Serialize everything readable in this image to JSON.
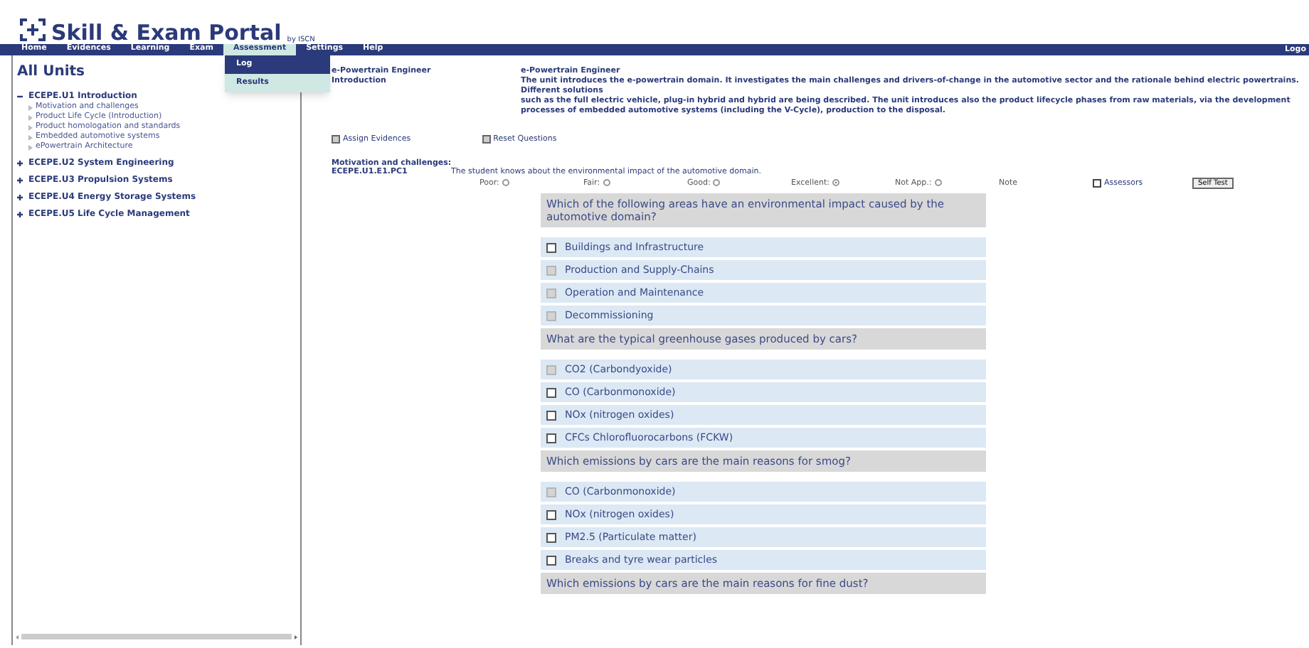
{
  "header": {
    "title": "Skill & Exam Portal",
    "byline": "by ISCN"
  },
  "nav": {
    "items": [
      {
        "label": "Home",
        "selected": false
      },
      {
        "label": "Evidences",
        "selected": false
      },
      {
        "label": "Learning",
        "selected": false
      },
      {
        "label": "Exam",
        "selected": false
      },
      {
        "label": "Assessment",
        "selected": true
      },
      {
        "label": "Settings",
        "selected": false
      },
      {
        "label": "Help",
        "selected": false
      }
    ],
    "right_link": "Logo",
    "dropdown": [
      {
        "label": "Log",
        "selected": true
      },
      {
        "label": "Results",
        "selected": false
      }
    ]
  },
  "sidebar": {
    "title": "All Units",
    "units": [
      {
        "label": "ECEPE.U1 Introduction",
        "expanded": true,
        "children": [
          {
            "label": "Motivation and challenges"
          },
          {
            "label": "Product Life Cycle (Introduction)"
          },
          {
            "label": "Product homologation and standards"
          },
          {
            "label": "Embedded automotive systems"
          },
          {
            "label": "ePowertrain Architecture"
          }
        ]
      },
      {
        "label": "ECEPE.U2 System Engineering",
        "expanded": false
      },
      {
        "label": "ECEPE.U3 Propulsion Systems",
        "expanded": false
      },
      {
        "label": "ECEPE.U4 Energy Storage Systems",
        "expanded": false
      },
      {
        "label": "ECEPE.U5 Life Cycle Management",
        "expanded": false
      }
    ]
  },
  "info": [
    {
      "label": "e-Powertrain Engineer",
      "value": "e-Powertrain Engineer"
    },
    {
      "label": "Introduction",
      "value": "The unit introduces the e-powertrain domain. It investigates the main challenges and drivers-of-change in the automotive sector and the rationale behind electric powertrains. Different solutions\nsuch as the full electric vehicle, plug-in hybrid and hybrid are being described. The unit introduces also the product lifecycle phases from raw materials, via the development processes of embedded automotive systems (including the V-Cycle), production to the disposal."
    }
  ],
  "actions": [
    "Assign Evidences",
    "Reset Questions"
  ],
  "section_title": "Motivation and challenges:",
  "criterion": {
    "code": "ECEPE.U1.E1.PC1",
    "text": "The student knows about the environmental impact of the automotive domain."
  },
  "ratings": [
    {
      "label": "Poor:",
      "selected": false
    },
    {
      "label": "Fair:",
      "selected": false
    },
    {
      "label": "Good:",
      "selected": false
    },
    {
      "label": "Excellent:",
      "selected": true
    },
    {
      "label": "Not App.:",
      "selected": false
    }
  ],
  "note": "Note",
  "assessors": "Assessors",
  "self_test": "Self Test",
  "questions": [
    {
      "text": "Which of the following areas have an environmental impact caused by the automotive domain?",
      "answers": [
        {
          "label": "Buildings and Infrastructure",
          "checked": false
        },
        {
          "label": "Production and Supply-Chains",
          "checked": true
        },
        {
          "label": "Operation and Maintenance",
          "checked": true
        },
        {
          "label": "Decommissioning",
          "checked": true
        }
      ]
    },
    {
      "text": "What are the typical greenhouse gases produced by cars?",
      "answers": [
        {
          "label": "CO2 (Carbondyoxide)",
          "checked": true
        },
        {
          "label": "CO (Carbonmonoxide)",
          "checked": false
        },
        {
          "label": "NOx (nitrogen oxides)",
          "checked": false
        },
        {
          "label": "CFCs Chlorofluorocarbons (FCKW)",
          "checked": false
        }
      ]
    },
    {
      "text": "Which emissions by cars are the main reasons for smog?",
      "answers": [
        {
          "label": "CO (Carbonmonoxide)",
          "checked": true
        },
        {
          "label": "NOx (nitrogen oxides)",
          "checked": false
        },
        {
          "label": "PM2.5 (Particulate matter)",
          "checked": false
        },
        {
          "label": "Breaks and tyre wear particles",
          "checked": false
        }
      ]
    },
    {
      "text": "Which emissions by cars are the main reasons for fine dust?"
    }
  ]
}
